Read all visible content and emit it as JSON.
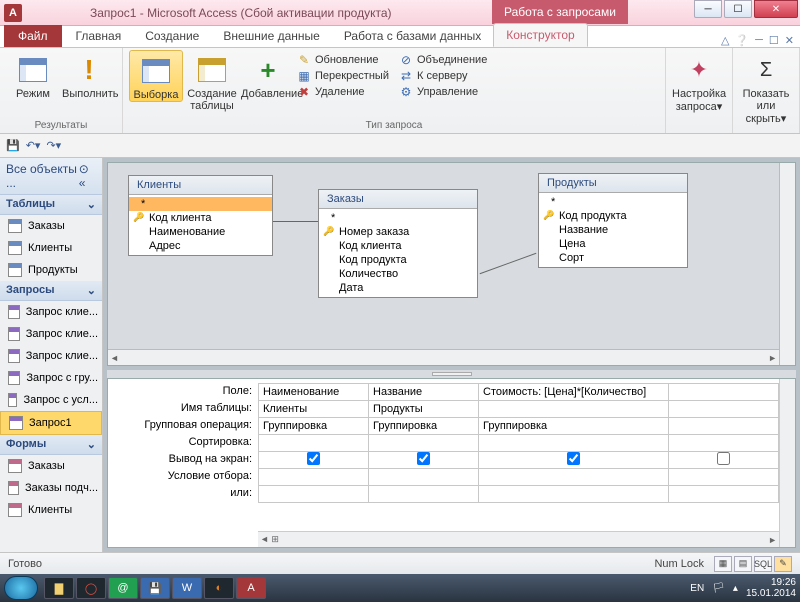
{
  "title": "Запрос1  -  Microsoft Access (Сбой активации продукта)",
  "context_tab": "Работа с запросами",
  "tabs": {
    "file": "Файл",
    "home": "Главная",
    "create": "Создание",
    "external": "Внешние данные",
    "dbtools": "Работа с базами данных",
    "design": "Конструктор"
  },
  "ribbon": {
    "results_group": "Результаты",
    "view": "Режим",
    "run": "Выполнить",
    "querytype_group": "Тип запроса",
    "select": "Выборка",
    "maketable": "Создание таблицы",
    "append": "Добавление",
    "update": "Обновление",
    "crosstab": "Перекрестный",
    "delete": "Удаление",
    "union": "Объединение",
    "passthrough": "К серверу",
    "datadef": "Управление",
    "querysetup": "Настройка запроса",
    "showhide": "Показать или скрыть",
    "sigma": "Σ",
    "arrow": "▾"
  },
  "nav": {
    "header": "Все объекты ...",
    "groups": {
      "tables": "Таблицы",
      "queries": "Запросы",
      "forms": "Формы"
    },
    "tables": [
      "Заказы",
      "Клиенты",
      "Продукты"
    ],
    "queries": [
      "Запрос клие...",
      "Запрос клие...",
      "Запрос клие...",
      "Запрос с гру...",
      "Запрос с усл...",
      "Запрос1"
    ],
    "forms": [
      "Заказы",
      "Заказы подч...",
      "Клиенты"
    ]
  },
  "design": {
    "t1": {
      "title": "Клиенты",
      "star": "*",
      "f1": "Код клиента",
      "f2": "Наименование",
      "f3": "Адрес"
    },
    "t2": {
      "title": "Заказы",
      "star": "*",
      "f1": "Номер заказа",
      "f2": "Код клиента",
      "f3": "Код продукта",
      "f4": "Количество",
      "f5": "Дата"
    },
    "t3": {
      "title": "Продукты",
      "star": "*",
      "f1": "Код продукта",
      "f2": "Название",
      "f3": "Цена",
      "f4": "Сорт"
    }
  },
  "grid": {
    "labels": {
      "field": "Поле:",
      "table": "Имя таблицы:",
      "total": "Групповая операция:",
      "sort": "Сортировка:",
      "show": "Вывод на экран:",
      "criteria": "Условие отбора:",
      "or": "или:"
    },
    "c1": {
      "field": "Наименование",
      "table": "Клиенты",
      "total": "Группировка"
    },
    "c2": {
      "field": "Название",
      "table": "Продукты",
      "total": "Группировка"
    },
    "c3": {
      "field": "Стоимость: [Цена]*[Количество]",
      "table": "",
      "total": "Группировка"
    }
  },
  "status": {
    "ready": "Готово",
    "numlock": "Num Lock",
    "sql": "SQL"
  },
  "taskbar": {
    "lang": "EN",
    "time": "19:26",
    "date": "15.01.2014"
  }
}
